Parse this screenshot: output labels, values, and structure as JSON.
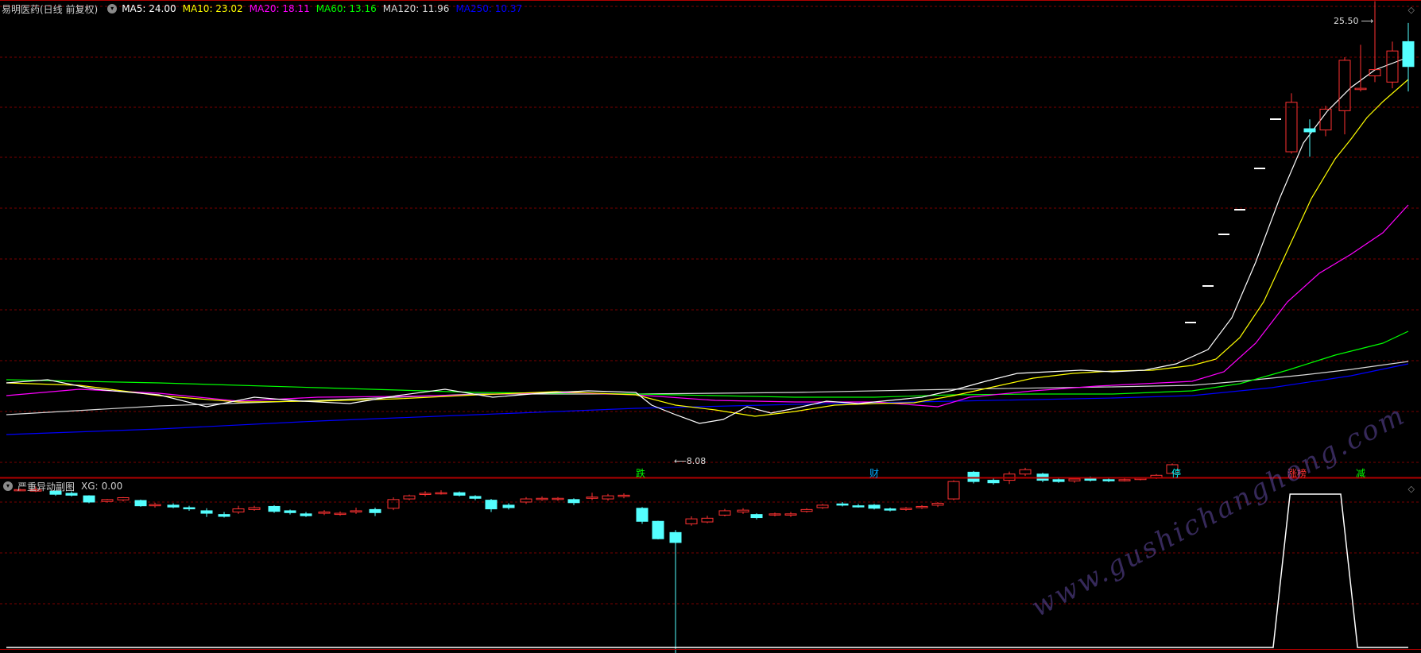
{
  "main_panel": {
    "stock_title": "易明医药(日线 前复权)",
    "indicators": [
      {
        "label": "MA5:",
        "value": "24.00",
        "color": "#ffffff"
      },
      {
        "label": "MA10:",
        "value": "23.02",
        "color": "#ffff00"
      },
      {
        "label": "MA20:",
        "value": "18.11",
        "color": "#ff00ff"
      },
      {
        "label": "MA60:",
        "value": "13.16",
        "color": "#00ff00"
      },
      {
        "label": "MA120:",
        "value": "11.96",
        "color": "#d8d8d8"
      },
      {
        "label": "MA250:",
        "value": "10.37",
        "color": "#0000ff"
      }
    ],
    "high_marker": "25.50",
    "low_marker": "8.08",
    "event_labels": [
      {
        "text": "跌",
        "color": "#00ff00"
      },
      {
        "text": "财",
        "color": "#00aaff"
      },
      {
        "text": "停",
        "color": "#00ffff"
      },
      {
        "text": "涨",
        "color": "#ff3333"
      },
      {
        "text": "榜",
        "color": "#ff3333"
      },
      {
        "text": "减",
        "color": "#00ff00"
      }
    ]
  },
  "sub_panel": {
    "title": "严重异动副图",
    "indicator_label": "XG:",
    "indicator_value": "0.00",
    "xg_values": [
      0,
      0,
      0,
      0,
      0,
      0,
      0,
      0,
      0,
      0,
      0,
      0,
      0,
      0,
      0,
      0,
      0,
      0,
      0,
      0,
      0,
      0,
      0,
      0,
      0,
      0,
      0,
      0,
      0,
      0,
      0,
      0,
      0,
      0,
      0,
      0,
      0,
      0,
      0,
      0,
      0,
      0,
      0,
      0,
      0,
      0,
      0,
      0,
      0,
      0,
      0,
      0,
      0,
      0,
      0,
      0,
      0,
      0,
      0,
      0,
      0,
      0,
      0,
      0,
      0,
      0,
      0,
      0,
      0,
      0,
      0,
      0,
      0,
      0,
      0,
      0,
      1,
      1,
      1,
      1,
      0,
      0,
      0,
      0
    ]
  },
  "watermark": "www.gushichanghong.com",
  "colors": {
    "up": "#ff3232",
    "down": "#54ffff",
    "grid": "#7a0000",
    "border": "#b00000"
  }
}
